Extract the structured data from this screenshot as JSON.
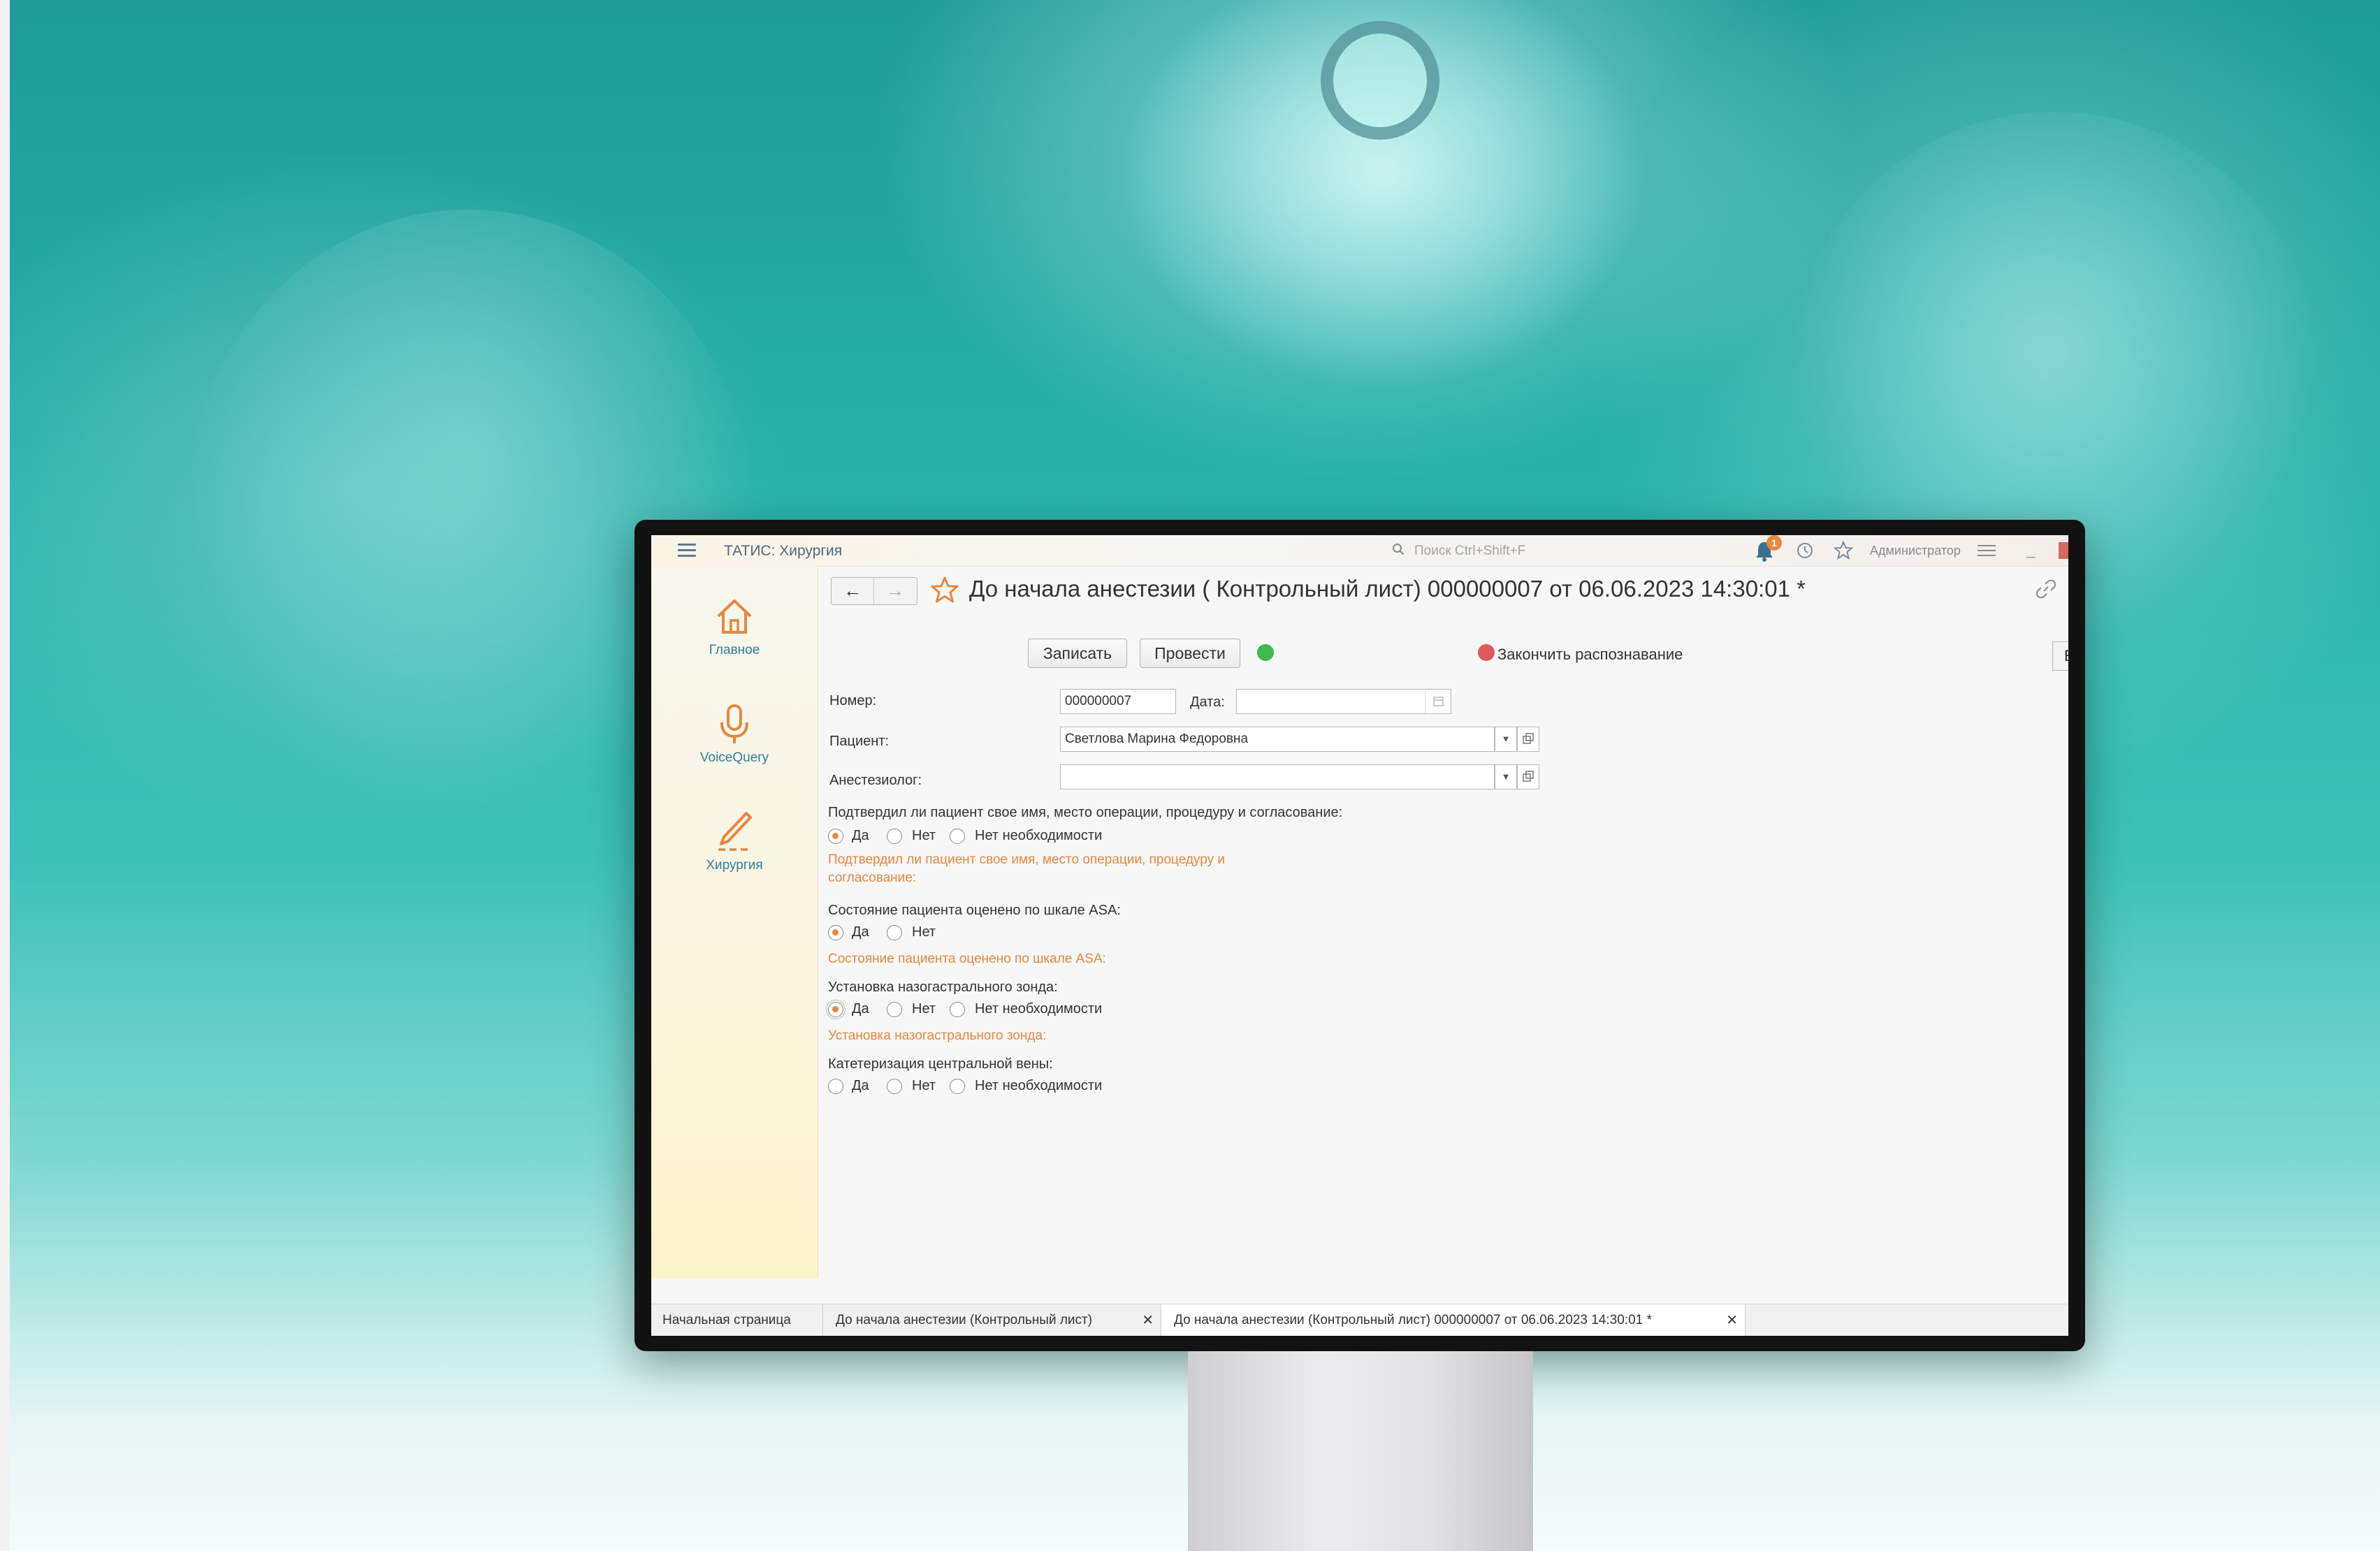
{
  "app": {
    "title": "ТАТИС: Хирургия"
  },
  "search": {
    "placeholder": "Поиск Ctrl+Shift+F"
  },
  "notifications": {
    "count": "1"
  },
  "user": {
    "name": "Администратор"
  },
  "sidebar": {
    "items": [
      {
        "label": "Главное",
        "icon": "home-icon"
      },
      {
        "label": "VoiceQuery",
        "icon": "microphone-icon"
      },
      {
        "label": "Хирургия",
        "icon": "scalpel-icon"
      }
    ]
  },
  "document": {
    "title": "До начала анестезии ( Контрольный лист) 000000007 от 06.06.2023 14:30:01 *",
    "save_label": "Записать",
    "post_label": "Провести",
    "end_recognition_label": "Закончить распознавание",
    "edge_button_label": "Е"
  },
  "form": {
    "number_label": "Номер:",
    "number_value": "000000007",
    "date_label": "Дата:",
    "date_value": "",
    "patient_label": "Пациент:",
    "patient_value": "Светлова Марина Федоровна",
    "anesthesiologist_label": "Анестезиолог:",
    "anesthesiologist_value": ""
  },
  "questions": [
    {
      "text": "Подтвердил ли пациент свое имя, место операции, процедуру и согласование:",
      "options": [
        "Да",
        "Нет",
        "Нет необходимости"
      ],
      "selected": "Да",
      "hint": "Подтвердил ли пациент свое имя, место операции, процедуру и согласование:"
    },
    {
      "text": "Состояние пациента оценено по шкале ASA:",
      "options": [
        "Да",
        "Нет"
      ],
      "selected": "Да",
      "hint": "Состояние пациента оценено по шкале ASA:"
    },
    {
      "text": "Установка назогастрального зонда:",
      "options": [
        "Да",
        "Нет",
        "Нет необходимости"
      ],
      "selected": "Да",
      "hint": "Установка назогастрального зонда:"
    },
    {
      "text": "Катетеризация центральной вены:",
      "options": [
        "Да",
        "Нет",
        "Нет необходимости"
      ],
      "selected": "",
      "hint": ""
    }
  ],
  "tabs": [
    {
      "label": "Начальная страница"
    },
    {
      "label": "До начала анестезии (Контрольный лист)"
    },
    {
      "label": "До начала анестезии (Контрольный лист) 000000007 от 06.06.2023 14:30:01 *"
    }
  ],
  "colors": {
    "accent": "#e8873e",
    "status_green": "#3dbb4c",
    "status_red": "#e05a57",
    "link_blue": "#2f7ea1"
  }
}
